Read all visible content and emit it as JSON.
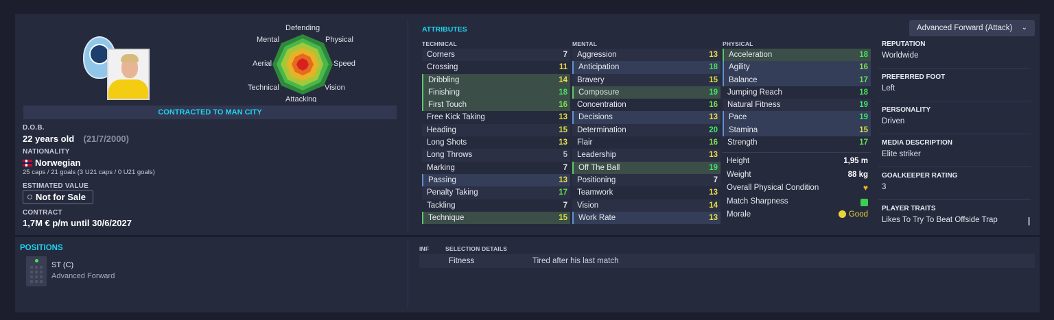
{
  "radar": {
    "defending": "Defending",
    "physical": "Physical",
    "mental": "Mental",
    "aerial": "Aerial",
    "speed": "Speed",
    "technical": "Technical",
    "vision": "Vision",
    "attacking": "Attacking"
  },
  "profile": {
    "contract_banner": "CONTRACTED TO MAN CITY",
    "dob_label": "D.O.B.",
    "age": "22 years old",
    "dob": "(21/7/2000)",
    "nationality_label": "NATIONALITY",
    "nationality": "Norwegian",
    "caps": "25 caps / 21 goals (3 U21 caps / 0 U21 goals)",
    "value_label": "ESTIMATED VALUE",
    "value": "Not for Sale",
    "contract_label": "CONTRACT",
    "contract": "1,7M € p/m until 30/6/2027"
  },
  "attributes": {
    "title": "ATTRIBUTES",
    "technical_header": "TECHNICAL",
    "mental_header": "MENTAL",
    "physical_header": "PHYSICAL",
    "technical": [
      {
        "name": "Corners",
        "value": "7"
      },
      {
        "name": "Crossing",
        "value": "11"
      },
      {
        "name": "Dribbling",
        "value": "14"
      },
      {
        "name": "Finishing",
        "value": "18"
      },
      {
        "name": "First Touch",
        "value": "16"
      },
      {
        "name": "Free Kick Taking",
        "value": "13"
      },
      {
        "name": "Heading",
        "value": "15"
      },
      {
        "name": "Long Shots",
        "value": "13"
      },
      {
        "name": "Long Throws",
        "value": "5"
      },
      {
        "name": "Marking",
        "value": "7"
      },
      {
        "name": "Passing",
        "value": "13"
      },
      {
        "name": "Penalty Taking",
        "value": "17"
      },
      {
        "name": "Tackling",
        "value": "7"
      },
      {
        "name": "Technique",
        "value": "15"
      }
    ],
    "mental": [
      {
        "name": "Aggression",
        "value": "13"
      },
      {
        "name": "Anticipation",
        "value": "18"
      },
      {
        "name": "Bravery",
        "value": "15"
      },
      {
        "name": "Composure",
        "value": "19"
      },
      {
        "name": "Concentration",
        "value": "16"
      },
      {
        "name": "Decisions",
        "value": "13"
      },
      {
        "name": "Determination",
        "value": "20"
      },
      {
        "name": "Flair",
        "value": "16"
      },
      {
        "name": "Leadership",
        "value": "13"
      },
      {
        "name": "Off The Ball",
        "value": "19"
      },
      {
        "name": "Positioning",
        "value": "7"
      },
      {
        "name": "Teamwork",
        "value": "13"
      },
      {
        "name": "Vision",
        "value": "14"
      },
      {
        "name": "Work Rate",
        "value": "13"
      }
    ],
    "physical": [
      {
        "name": "Acceleration",
        "value": "18"
      },
      {
        "name": "Agility",
        "value": "16"
      },
      {
        "name": "Balance",
        "value": "17"
      },
      {
        "name": "Jumping Reach",
        "value": "18"
      },
      {
        "name": "Natural Fitness",
        "value": "19"
      },
      {
        "name": "Pace",
        "value": "19"
      },
      {
        "name": "Stamina",
        "value": "15"
      },
      {
        "name": "Strength",
        "value": "17"
      }
    ]
  },
  "physical_info": {
    "height_label": "Height",
    "height": "1,95 m",
    "weight_label": "Weight",
    "weight": "88 kg",
    "condition_label": "Overall Physical Condition",
    "sharpness_label": "Match Sharpness",
    "morale_label": "Morale",
    "morale": "Good"
  },
  "role_dropdown": "Advanced Forward (Attack)",
  "side": {
    "reputation_label": "REPUTATION",
    "reputation": "Worldwide",
    "foot_label": "PREFERRED FOOT",
    "foot": "Left",
    "personality_label": "PERSONALITY",
    "personality": "Driven",
    "media_label": "MEDIA DESCRIPTION",
    "media": "Elite striker",
    "gk_label": "GOALKEEPER RATING",
    "gk": "3",
    "traits_label": "PLAYER TRAITS",
    "traits": "Likes To Try To Beat Offside Trap"
  },
  "positions": {
    "title": "POSITIONS",
    "position": "ST (C)",
    "role": "Advanced Forward"
  },
  "selection": {
    "inf_header": "INF",
    "details_header": "SELECTION DETAILS",
    "fitness_label": "Fitness",
    "fitness_text": "Tired after his last match"
  },
  "colors": {
    "accent": "#1ed4f0",
    "panel": "#262a3d",
    "background": "#1c1e2e"
  },
  "icons": {
    "condition": "heart-icon",
    "sharpness": "sharpness-icon",
    "morale": "morale-icon",
    "dropdown": "chevron-down-icon"
  }
}
